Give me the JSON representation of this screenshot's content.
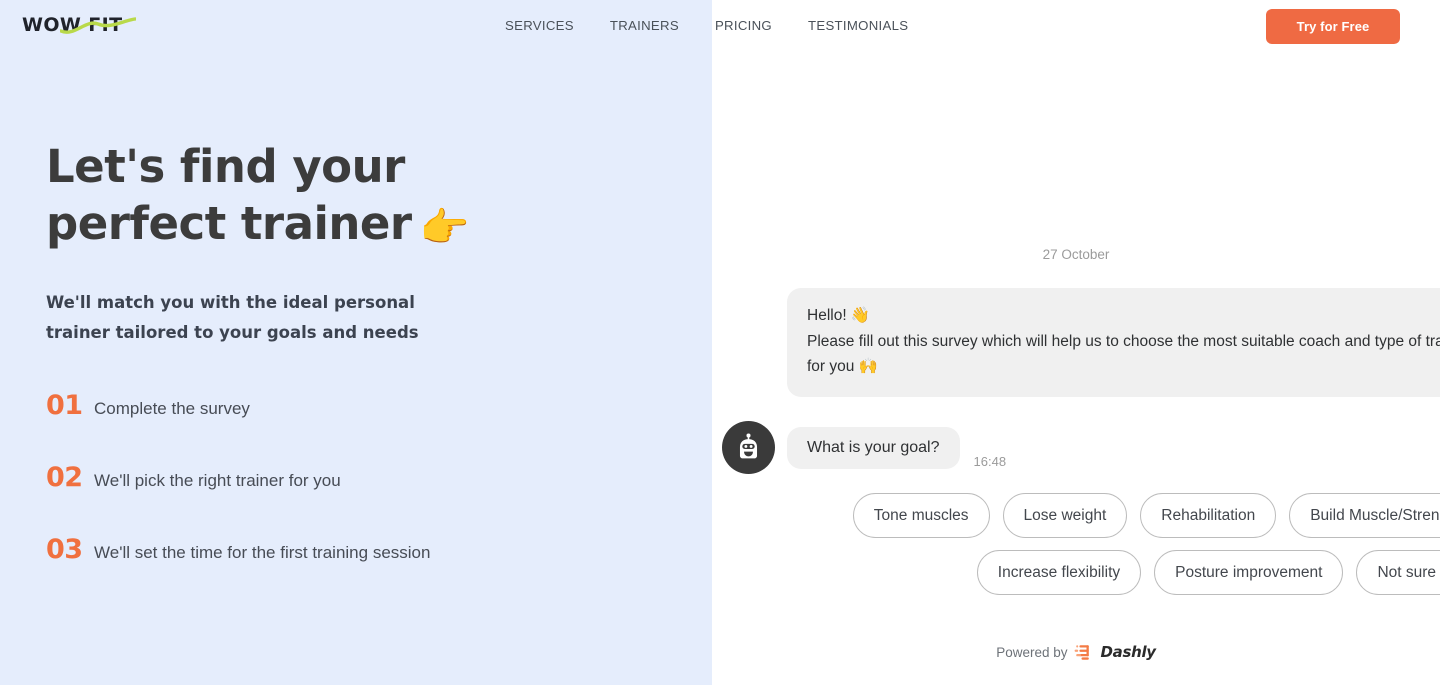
{
  "brand": {
    "logo_text": "WOW FIT",
    "logo_accent_color": "#b9d94a"
  },
  "header": {
    "nav": [
      {
        "label": "SERVICES"
      },
      {
        "label": "TRAINERS"
      },
      {
        "label": "PRICING"
      },
      {
        "label": "TESTIMONIALS"
      }
    ],
    "cta_label": "Try for Free",
    "cta_color": "#ef6a43"
  },
  "hero": {
    "title": "Let's find your\nperfect trainer",
    "title_emoji": "👉",
    "subtitle": "We'll match you with the ideal personal trainer tailored to your goals and needs",
    "steps": [
      {
        "number": "01",
        "label": "Complete the survey"
      },
      {
        "number": "02",
        "label": "We'll pick the right trainer for you"
      },
      {
        "number": "03",
        "label": "We'll set the time for the first training session"
      }
    ],
    "panel_color": "#e5edfc",
    "step_number_color": "#f0703f"
  },
  "chat": {
    "date_divider": "27 October",
    "messages": [
      {
        "sender": "bot",
        "text": "Hello! 👋\nPlease fill out this survey which will help us to choose the most suitable coach and type of training for you 🙌",
        "has_avatar": false,
        "time": ""
      },
      {
        "sender": "bot",
        "text": "What is your goal?",
        "has_avatar": true,
        "avatar_icon": "robot-icon",
        "time": "16:48"
      }
    ],
    "quick_replies": [
      {
        "label": "Tone muscles"
      },
      {
        "label": "Lose weight"
      },
      {
        "label": "Rehabilitation"
      },
      {
        "label": "Build Muscle/Strength"
      },
      {
        "label": "Increase flexibility"
      },
      {
        "label": "Posture improvement"
      },
      {
        "label": "Not sure yet"
      }
    ],
    "footer": {
      "powered_label": "Powered by",
      "vendor_name": "Dashly",
      "vendor_mark_color": "#f47b45"
    }
  }
}
